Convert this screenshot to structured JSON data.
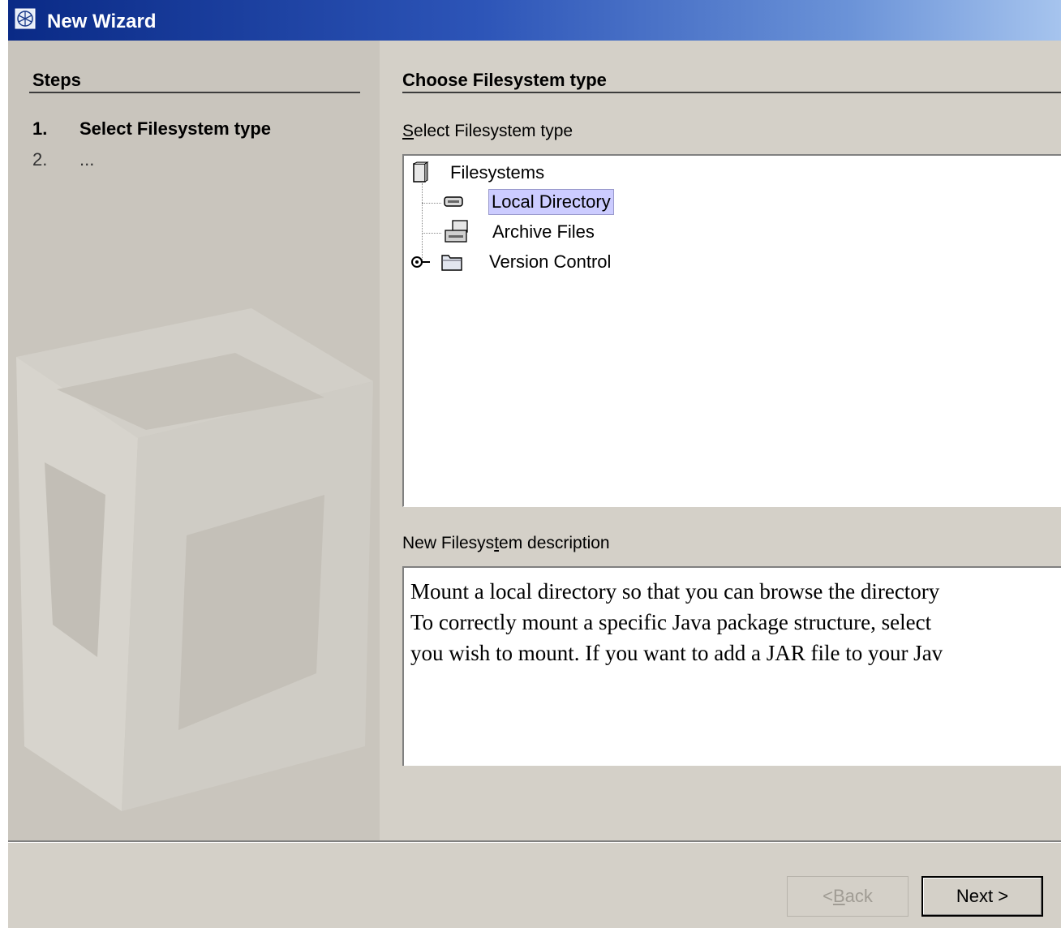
{
  "window": {
    "title": "New Wizard"
  },
  "steps": {
    "heading": "Steps",
    "items": [
      {
        "number": "1.",
        "label": "Select Filesystem type",
        "active": true
      },
      {
        "number": "2.",
        "label": "...",
        "active": false
      }
    ]
  },
  "main": {
    "heading": "Choose Filesystem type",
    "tree_label": "Select Filesystem type",
    "tree": {
      "root": "Filesystems",
      "children": [
        {
          "label": "Local Directory",
          "selected": true,
          "icon": "drive-icon"
        },
        {
          "label": "Archive Files",
          "selected": false,
          "icon": "archive-icon"
        },
        {
          "label": "Version Control",
          "selected": false,
          "icon": "folder-icon",
          "expandable": true
        }
      ]
    },
    "description_label": "New Filesystem description",
    "description": "Mount a local directory so that you can browse the directory\nTo correctly mount a specific Java package structure, select\nyou wish to mount. If you want to add a JAR file to your Jav"
  },
  "buttons": {
    "back": "< Back",
    "next": "Next >"
  },
  "colors": {
    "title_bar": "#0a2a86",
    "selection": "#ccccff",
    "window_bg": "#d4d0c8"
  }
}
